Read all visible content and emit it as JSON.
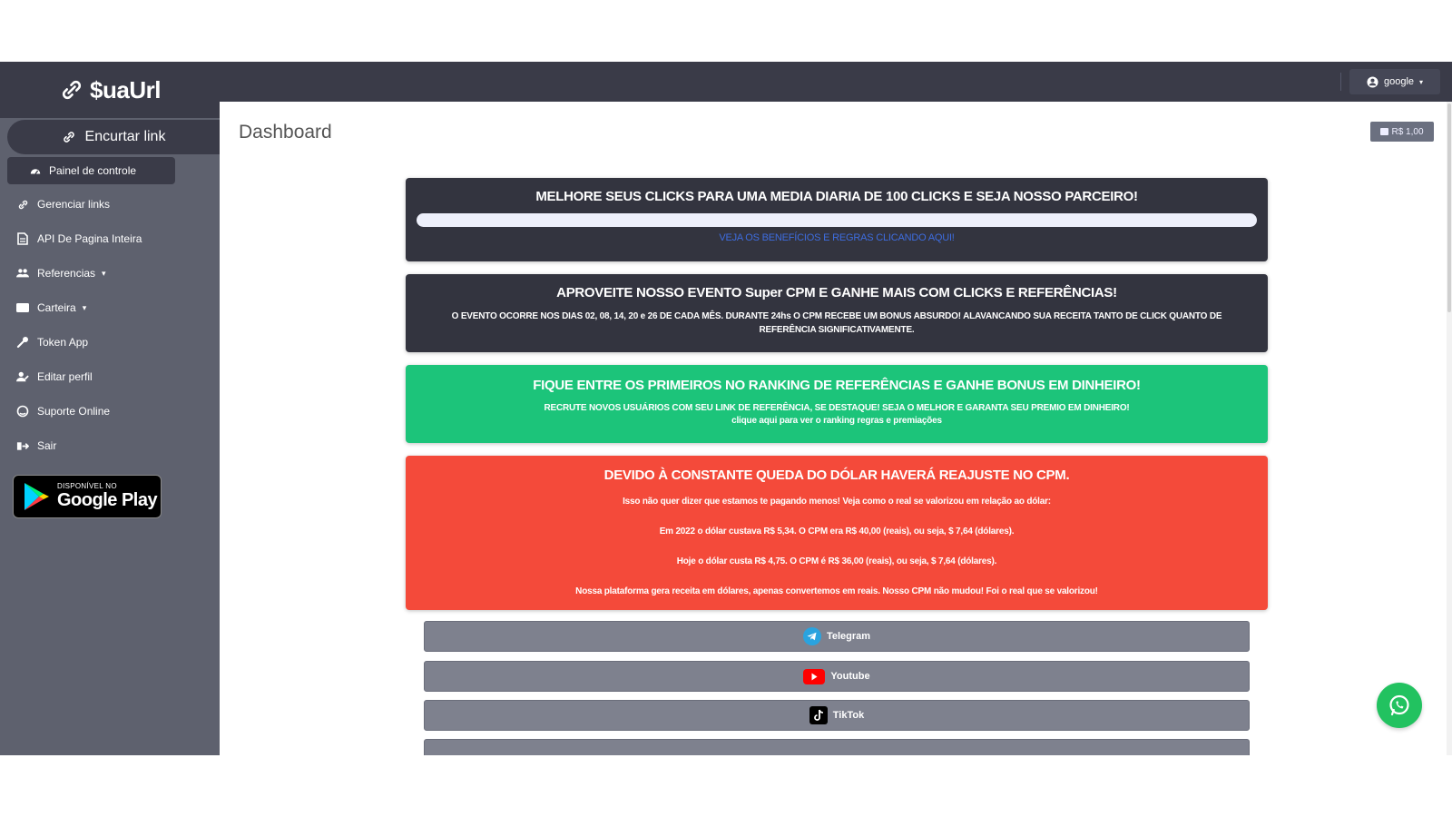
{
  "brand": {
    "name": "$uaUrl",
    "icon": "link-icon"
  },
  "sidebar": {
    "shorten_label": "Encurtar link",
    "active_item": {
      "label": "Painel de controle",
      "icon": "dashboard-icon"
    },
    "items": [
      {
        "label": "Gerenciar links",
        "icon": "link-icon"
      },
      {
        "label": "API De Pagina Inteira",
        "icon": "file-icon"
      },
      {
        "label": "Referencias",
        "icon": "users-icon",
        "caret": "▾"
      },
      {
        "label": "Carteira",
        "icon": "wallet-icon",
        "caret": "▾"
      },
      {
        "label": "Token App",
        "icon": "key-icon"
      },
      {
        "label": "Editar perfil",
        "icon": "user-edit-icon"
      },
      {
        "label": "Suporte Online",
        "icon": "support-icon"
      },
      {
        "label": "Sair",
        "icon": "logout-icon"
      }
    ],
    "google_play": {
      "small": "DISPONÍVEL NO",
      "big": "Google Play"
    }
  },
  "topbar": {
    "user_label": "google",
    "user_caret": "▾"
  },
  "page": {
    "title": "Dashboard",
    "balance": "R$ 1,00"
  },
  "cards": {
    "progress": {
      "title": "MELHORE SEUS CLICKS PARA UMA MEDIA DIARIA DE 100 CLICKS E SEJA NOSSO PARCEIRO!",
      "link": "VEJA OS BENEFÍCIOS E REGRAS CLICANDO AQUI!",
      "progress_fraction": 0
    },
    "event": {
      "title": "APROVEITE NOSSO EVENTO Super CPM E GANHE MAIS COM CLICKS E REFERÊNCIAS!",
      "text": "O EVENTO OCORRE NOS DIAS 02, 08, 14, 20 e 26 DE CADA MÊS. DURANTE 24hs O CPM RECEBE UM BONUS ABSURDO! ALAVANCANDO SUA RECEITA TANTO DE CLICK QUANTO DE REFERÊNCIA SIGNIFICATIVAMENTE."
    },
    "ranking": {
      "title": "FIQUE ENTRE OS PRIMEIROS NO RANKING DE REFERÊNCIAS E GANHE BONUS EM DINHEIRO!",
      "line1": "RECRUTE NOVOS USUÁRIOS COM SEU LINK DE REFERÊNCIA, SE DESTAQUE! SEJA O MELHOR E GARANTA SEU PREMIO EM DINHEIRO!",
      "line2": "clique aqui para ver o ranking regras e premiações"
    },
    "dollar": {
      "title": "DEVIDO À CONSTANTE QUEDA DO DÓLAR HAVERÁ REAJUSTE NO CPM.",
      "lines": [
        "Isso não quer dizer que estamos te pagando menos! Veja como o real se valorizou em relação ao dólar:",
        "Em 2022 o dólar custava R$ 5,34. O CPM era R$ 40,00 (reais), ou seja, $ 7,64 (dólares).",
        "Hoje o dólar custa R$ 4,75. O CPM é R$ 36,00 (reais), ou seja, $ 7,64 (dólares).",
        "Nossa plataforma gera receita em dólares, apenas convertemos em reais. Nosso CPM não mudou! Foi o real que se valorizou!"
      ]
    }
  },
  "social": [
    {
      "label": "Telegram",
      "icon": "telegram-icon"
    },
    {
      "label": "Youtube",
      "icon": "youtube-icon"
    },
    {
      "label": "TikTok",
      "icon": "tiktok-icon"
    }
  ],
  "colors": {
    "sidebar": "#5e616e",
    "dark": "#3a3b48",
    "green": "#1cc47a",
    "red": "#f44a3a",
    "whatsapp": "#22c260"
  }
}
